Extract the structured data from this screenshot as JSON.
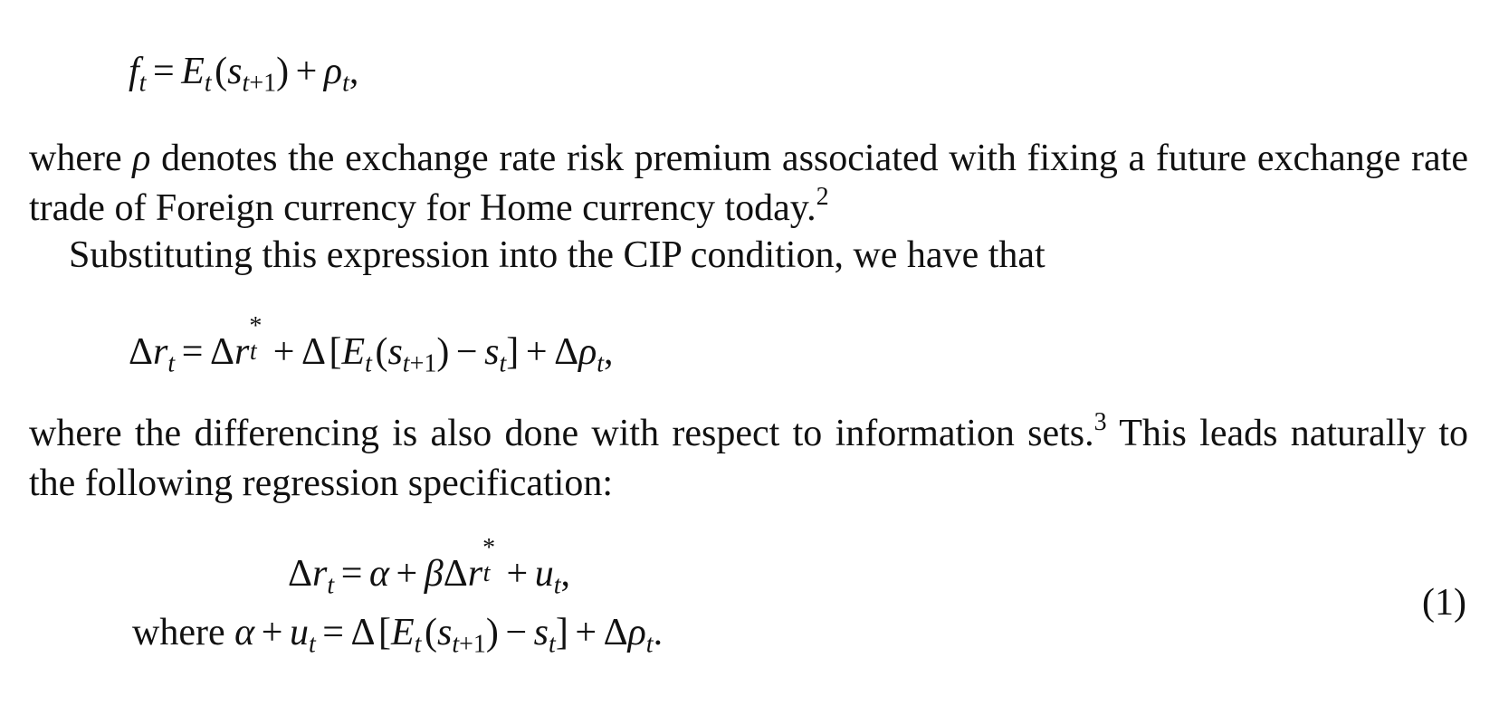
{
  "equation_1": "f_t = E_t (s_{t+1}) + ρ_t,",
  "paragraph_1": "where ρ denotes the exchange rate risk premium associated with fixing a future exchange rate trade of Foreign currency for Home currency today.",
  "footnote_marker_2": "2",
  "paragraph_2": "Substituting this expression into the CIP condition, we have that",
  "equation_2": "Δr_t = Δr*_t + Δ [E_t (s_{t+1}) − s_t] + Δρ_t,",
  "paragraph_3_part1": "where the differencing is also done with respect to information sets.",
  "footnote_marker_3": "3",
  "paragraph_3_part2": "This leads naturally to the following regression specification:",
  "equation_3a": "Δr_t = α + βΔr*_t + u_t,",
  "equation_3b": "where α + u_t = Δ [E_t (s_{t+1}) − s_t] + Δρ_t.",
  "equation_number": "(1)"
}
